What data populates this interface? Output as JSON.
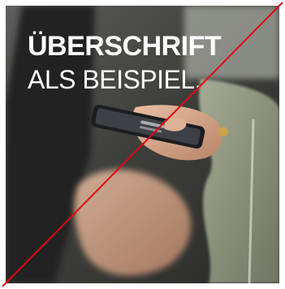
{
  "headline": {
    "line1": "ÜBERSCHRIFT",
    "line2": "ALS BEISPIEL."
  },
  "colors": {
    "frame": "#ffffff",
    "text": "#ffffff",
    "slash": "#e30613",
    "jacket": "#8a9178",
    "phone": "#1c1d1f"
  }
}
